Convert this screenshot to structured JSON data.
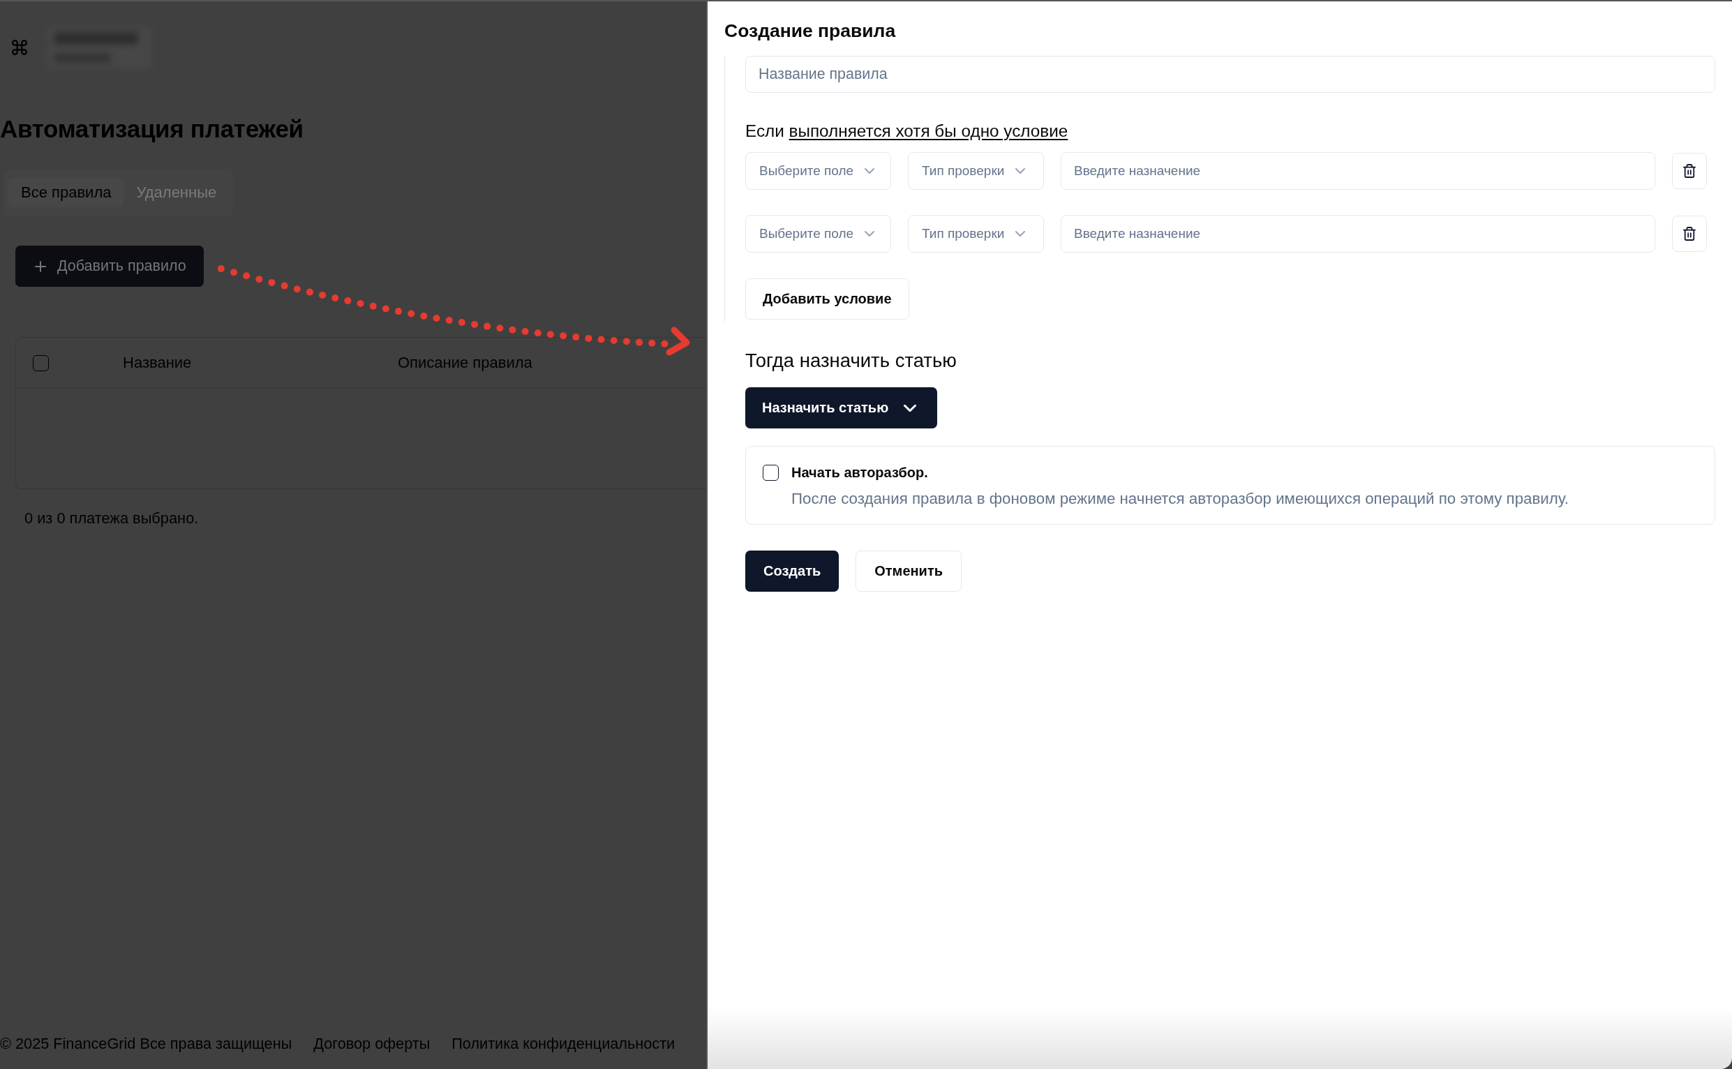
{
  "page": {
    "title": "Автоматизация платежей",
    "tabs": [
      {
        "label": "Все правила",
        "selected": true
      },
      {
        "label": "Удаленные",
        "selected": false
      }
    ],
    "add_button": {
      "label": "Добавить правило"
    },
    "table": {
      "select_all": {
        "checked": false
      },
      "columns": [
        "Название",
        "Описание правила"
      ]
    },
    "selection_status": "0 из 0 платежа выбрано.",
    "footer": {
      "copyright": "© 2025 FinanceGrid Все права защищены",
      "links": [
        "Договор оферты",
        "Политика конфиденциальности"
      ]
    }
  },
  "rule_panel": {
    "title": "Создание правила",
    "name_field": {
      "placeholder": "Название правила"
    },
    "condition_heading": {
      "prefix": "Если",
      "mode_link": "выполняется хотя бы одно условие"
    },
    "conditions": [
      {
        "field_select": {
          "placeholder": "Выберите поле"
        },
        "check_type_select": {
          "placeholder": "Тип проверки"
        },
        "value_field": {
          "placeholder": "Введите назначение"
        }
      },
      {
        "field_select": {
          "placeholder": "Выберите поле"
        },
        "check_type_select": {
          "placeholder": "Тип проверки"
        },
        "value_field": {
          "placeholder": "Введите назначение"
        }
      }
    ],
    "add_condition_button": {
      "label": "Добавить условие"
    },
    "action_heading": "Тогда назначить статью",
    "assign_button": {
      "label": "Назначить статью"
    },
    "autoparse": {
      "checked": false,
      "label": "Начать авторазбор.",
      "description": "После создания правила в фоновом режиме начнется авторазбор имеющихся операций по этому правилу."
    },
    "buttons": [
      {
        "label": "Создать",
        "kind": "primary"
      },
      {
        "label": "Отменить",
        "kind": "secondary"
      }
    ]
  }
}
